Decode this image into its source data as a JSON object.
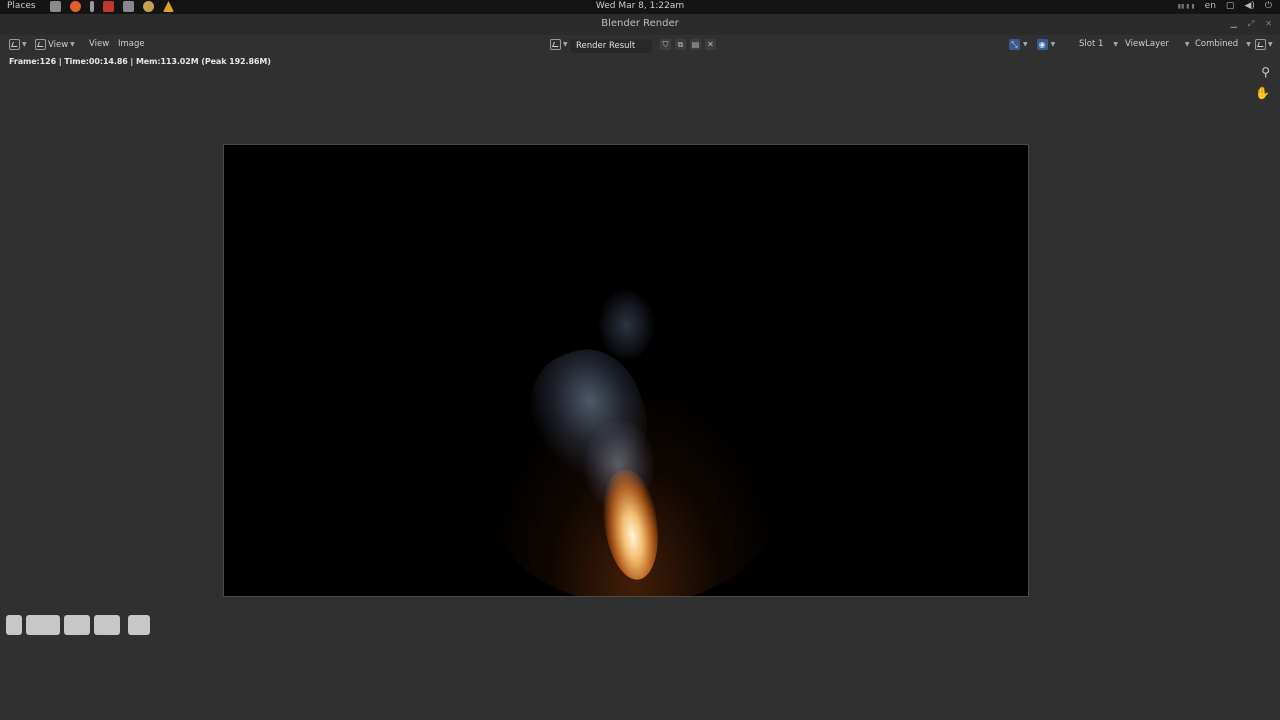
{
  "sysbar": {
    "places": "Places",
    "clock": "Wed Mar  8,  1:22am",
    "lang": "en",
    "app_colors": [
      "#8a8a8a",
      "#e0602a",
      "#999999",
      "#c0392b",
      "#888888",
      "#c8a050",
      "#e0a020"
    ]
  },
  "window": {
    "title": "Blender Render"
  },
  "header": {
    "view_menu": "View",
    "view2": "View",
    "image": "Image",
    "render_result": "Render Result",
    "slot": "Slot 1",
    "view_layer": "ViewLayer",
    "pass": "Combined"
  },
  "info": {
    "text": "Frame:126 | Time:00:14.86 | Mem:113.02M (Peak 192.86M)"
  }
}
